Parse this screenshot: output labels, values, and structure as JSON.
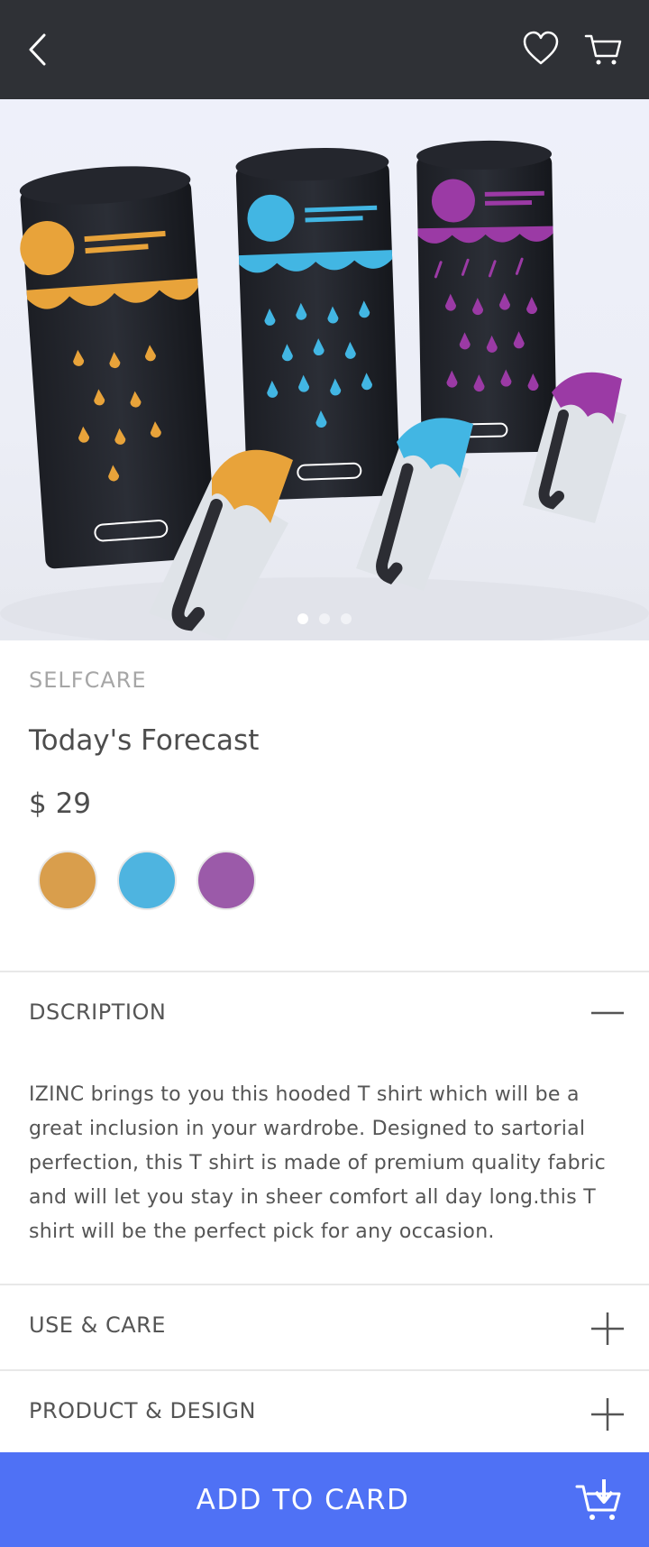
{
  "header": {
    "back_icon": "chevron-left-icon",
    "wishlist_icon": "heart-icon",
    "cart_icon": "cart-icon"
  },
  "gallery": {
    "image": "three packaged product tubes (orange, blue, purple) with umbrella-shaped applicators",
    "slide_count": 3,
    "active_slide": 1
  },
  "product": {
    "category": "SELFCARE",
    "name": "Today's Forecast",
    "price": "$ 29",
    "colors": [
      "#d99e4c",
      "#4eb4e0",
      "#9b5aa9"
    ]
  },
  "sections": {
    "description": {
      "label": "DSCRIPTION",
      "expanded": true,
      "text": "IZINC brings to you this hooded T shirt which will be a great inclusion in your wardrobe. Designed to sartorial perfection, this T shirt is made of premium quality fabric and will let you stay in sheer comfort all day long.this T shirt will be the perfect pick for any occasion."
    },
    "use_care": {
      "label": "USE & CARE",
      "expanded": false
    },
    "product_design": {
      "label": "PRODUCT & DESIGN",
      "expanded": false
    }
  },
  "cta": {
    "label": "ADD TO CARD",
    "icon": "cart-download-icon",
    "color": "#4f71f5"
  },
  "theme": {
    "topbar_bg": "#2f3136",
    "text": "#4d4d4d",
    "muted": "#a6a6a6"
  }
}
